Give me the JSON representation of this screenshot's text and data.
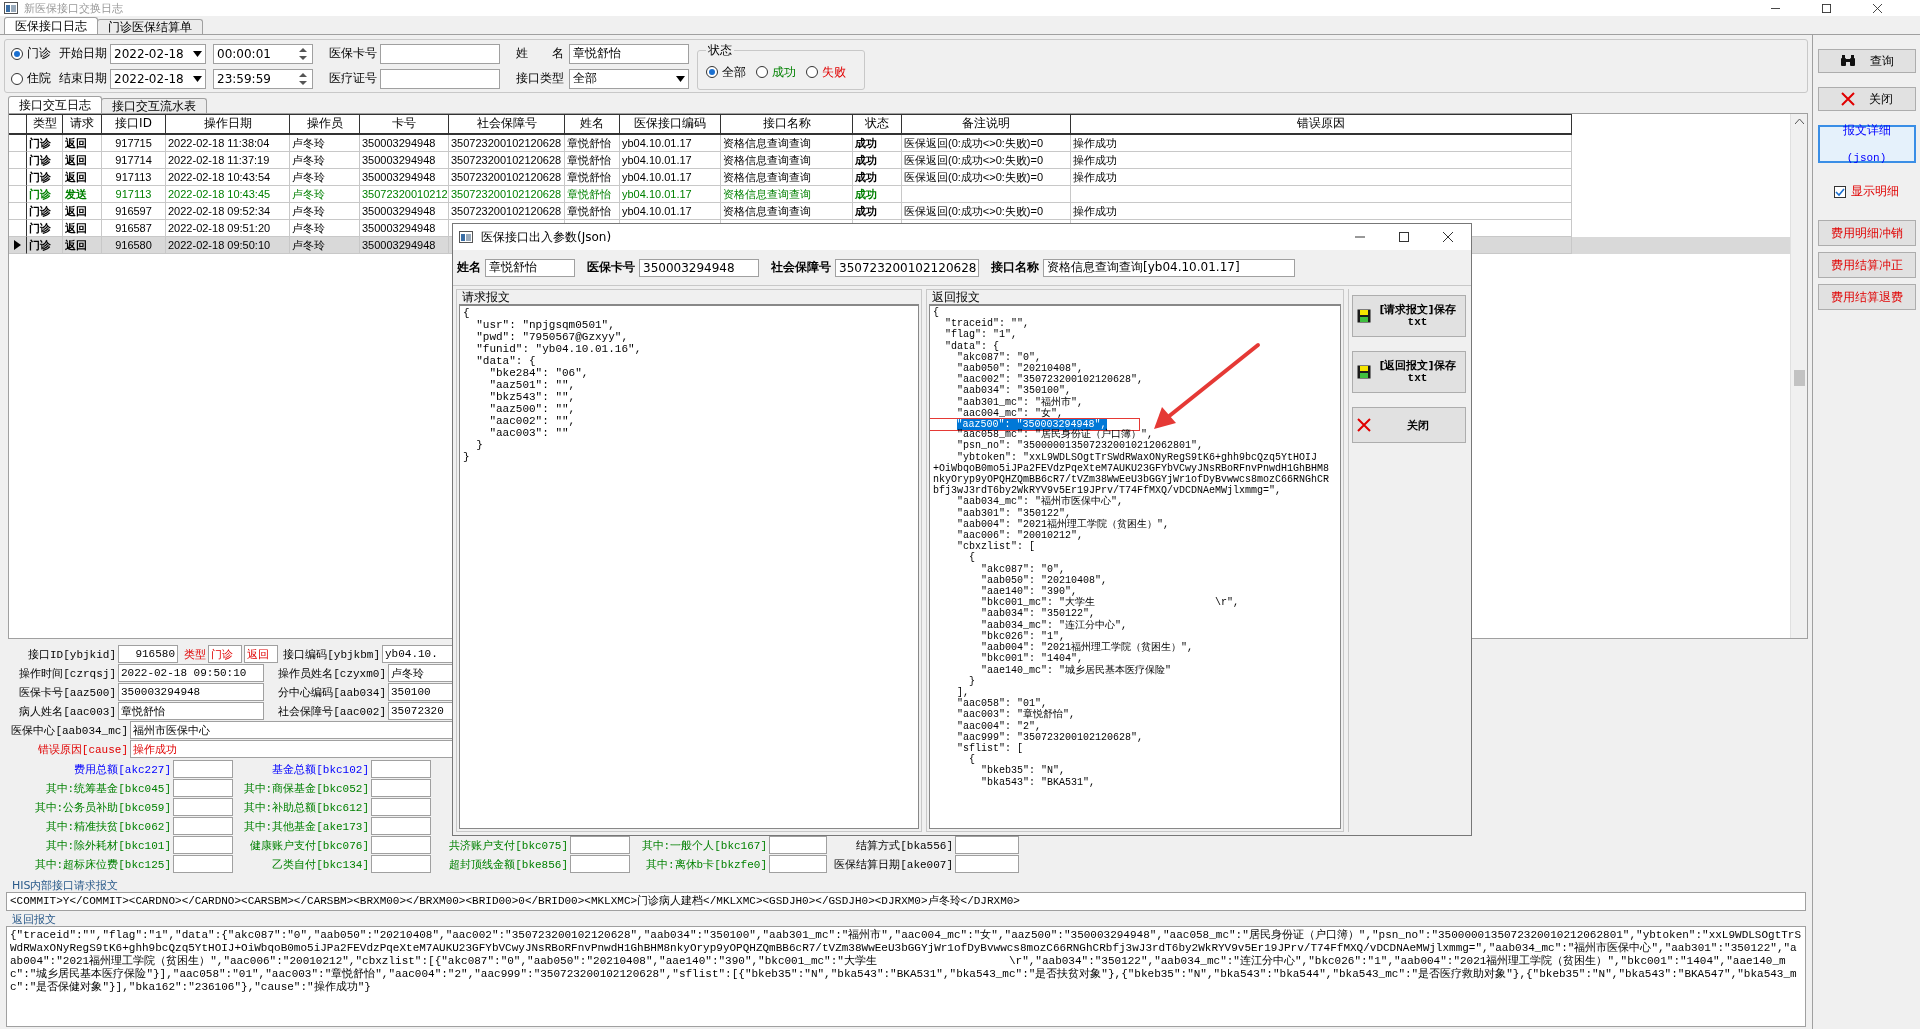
{
  "window": {
    "title": "新医保接口交换日志"
  },
  "main_tabs": [
    {
      "label": "医保接口日志",
      "selected": true
    },
    {
      "label": "门诊医保结算单",
      "selected": false
    }
  ],
  "filter": {
    "visit_types": [
      {
        "label": "门诊",
        "selected": true
      },
      {
        "label": "住院",
        "selected": false
      }
    ],
    "start_date": {
      "label": "开始日期",
      "date": "2022-02-18",
      "time": "00:00:01"
    },
    "end_date": {
      "label": "结束日期",
      "date": "2022-02-18",
      "time": "23:59:59"
    },
    "card_no": {
      "label": "医保卡号"
    },
    "medical_no": {
      "label": "医疗证号"
    },
    "name": {
      "label": "姓　　名",
      "value": "章悦舒怡"
    },
    "interface_type": {
      "label": "接口类型",
      "value": "全部"
    },
    "status": {
      "title": "状态",
      "options": [
        {
          "label": "全部",
          "kind": "all",
          "selected": true
        },
        {
          "label": "成功",
          "kind": "success",
          "selected": false
        },
        {
          "label": "失败",
          "kind": "fail",
          "selected": false
        }
      ]
    }
  },
  "sub_tabs": [
    {
      "label": "接口交互日志",
      "selected": true
    },
    {
      "label": "接口交互流水表",
      "selected": false
    }
  ],
  "table": {
    "columns": [
      "类型",
      "请求",
      "接口ID",
      "操作日期",
      "操作员",
      "卡号",
      "社会保障号",
      "姓名",
      "医保接口编码",
      "接口名称",
      "状态",
      "备注说明",
      "错误原因"
    ],
    "rows": [
      {
        "kind": "return",
        "selected": false,
        "cells": [
          "门诊",
          "返回",
          "917715",
          "2022-02-18 11:38:04",
          "卢冬玲",
          "350003294948",
          "350723200102120628",
          "章悦舒怡",
          "yb04.10.01.17",
          "资格信息查询查询",
          "成功",
          "医保返回(0:成功<>0:失败)=0",
          "操作成功"
        ]
      },
      {
        "kind": "return",
        "selected": false,
        "cells": [
          "门诊",
          "返回",
          "917714",
          "2022-02-18 11:37:19",
          "卢冬玲",
          "350003294948",
          "350723200102120628",
          "章悦舒怡",
          "yb04.10.01.17",
          "资格信息查询查询",
          "成功",
          "医保返回(0:成功<>0:失败)=0",
          "操作成功"
        ]
      },
      {
        "kind": "return",
        "selected": false,
        "cells": [
          "门诊",
          "返回",
          "917113",
          "2022-02-18 10:43:54",
          "卢冬玲",
          "350003294948",
          "350723200102120628",
          "章悦舒怡",
          "yb04.10.01.17",
          "资格信息查询查询",
          "成功",
          "医保返回(0:成功<>0:失败)=0",
          "操作成功"
        ]
      },
      {
        "kind": "send",
        "selected": false,
        "cells": [
          "门诊",
          "发送",
          "917113",
          "2022-02-18 10:43:45",
          "卢冬玲",
          "35072320010212",
          "350723200102120628",
          "章悦舒怡",
          "yb04.10.01.17",
          "资格信息查询查询",
          "成功"
        ]
      },
      {
        "kind": "return",
        "selected": false,
        "cells": [
          "门诊",
          "返回",
          "916597",
          "2022-02-18 09:52:34",
          "卢冬玲",
          "350003294948",
          "350723200102120628",
          "章悦舒怡",
          "yb04.10.01.17",
          "资格信息查询查询",
          "成功",
          "医保返回(0:成功<>0:失败)=0",
          "操作成功"
        ]
      },
      {
        "kind": "return",
        "selected": false,
        "cells": [
          "门诊",
          "返回",
          "916587",
          "2022-02-18 09:51:20",
          "卢冬玲",
          "350003294948"
        ]
      },
      {
        "kind": "return",
        "selected": true,
        "cells": [
          "门诊",
          "返回",
          "916580",
          "2022-02-18 09:50:10",
          "卢冬玲",
          "350003294948"
        ]
      }
    ]
  },
  "detail": {
    "id": {
      "label": "接口ID[ybjkid]",
      "value": "916580"
    },
    "type": {
      "label": "类型",
      "values": [
        "门诊",
        "返回"
      ]
    },
    "code": {
      "label": "接口编码[ybjkbm]",
      "value": "yb04.10."
    },
    "pairs": [
      [
        {
          "label": "操作时间[czrqsj]",
          "value": "2022-02-18 09:50:10"
        },
        {
          "label": "操作员姓名[czyxm0]",
          "value": "卢冬玲"
        }
      ],
      [
        {
          "label": "医保卡号[aaz500]",
          "value": "350003294948"
        },
        {
          "label": "分中心编码[aab034]",
          "value": "350100"
        }
      ],
      [
        {
          "label": "病人姓名[aac003]",
          "value": "章悦舒怡"
        },
        {
          "label": "社会保障号[aac002]",
          "value": "35072320"
        }
      ]
    ],
    "center": {
      "label": "医保中心[aab034_mc]",
      "value": "福州市医保中心"
    },
    "cause": {
      "label": "错误原因[cause]",
      "value": "操作成功"
    }
  },
  "fees": [
    [
      {
        "label": "费用总额[akc227]",
        "kind": "total"
      },
      {
        "label": "基金总额[bkc102]",
        "kind": "total"
      }
    ],
    [
      {
        "label": "其中:统筹基金[bkc045]",
        "kind": "part"
      },
      {
        "label": "其中:商保基金[bkc052]",
        "kind": "part"
      }
    ],
    [
      {
        "label": "其中:公务员补助[bkc059]",
        "kind": "part"
      },
      {
        "label": "其中:补助总额[bkc612]",
        "kind": "part"
      }
    ],
    [
      {
        "label": "其中:精准扶贫[bkc062]",
        "kind": "part"
      },
      {
        "label": "其中:其他基金[ake173]",
        "kind": "part"
      }
    ],
    [
      {
        "label": "其中:除外耗材[bkc101]",
        "kind": "part"
      },
      {
        "label": "健康账户支付[bkc076]",
        "kind": "part"
      },
      {
        "label": "共济账户支付[bkc075]",
        "kind": "part"
      },
      {
        "label": "其中:一般个人[bkc167]",
        "kind": "part"
      },
      {
        "label": "结算方式[bka556]",
        "kind": "plain"
      }
    ],
    [
      {
        "label": "其中:超标床位费[bkc125]",
        "kind": "part"
      },
      {
        "label": "乙类自付[bkc134]",
        "kind": "part"
      },
      {
        "label": "超封顶线金额[bke856]",
        "kind": "part"
      },
      {
        "label": "其中:离休b卡[bkzfe0]",
        "kind": "part"
      },
      {
        "label": "医保结算日期[ake007]",
        "kind": "plain"
      }
    ]
  ],
  "his_request": {
    "title": "HIS内部接口请求报文",
    "text": "<COMMIT>Y</COMMIT><CARDNO></CARDNO><CARSBM></CARSBM><BRXM00></BRXM00><BRID00>0</BRID00><MKLXMC>门诊病人建档</MKLXMC><GSDJH0></GSDJH0><DJRXM0>卢冬玲</DJRXM0>"
  },
  "his_response": {
    "title": "返回报文",
    "text": "{\"traceid\":\"\",\"flag\":\"1\",\"data\":{\"akc087\":\"0\",\"aab050\":\"20210408\",\"aac002\":\"350723200102120628\",\"aab034\":\"350100\",\"aab301_mc\":\"福州市\",\"aac004_mc\":\"女\",\"aaz500\":\"350003294948\",\"aac058_mc\":\"居民身份证（户口簿）\",\"psn_no\":\"3500000135072320010212062801\",\"ybtoken\":\"xxL9WDLSOgtTrSWdRWaxONyRegS9tK6+ghh9bcQzq5YtHOIJ+OiWbqoB0mo5iJPa2FEVdzPqeXteM7AUKU23GFYbVCwyJNsRBoRFnvPnwdH1GhBHM8nkyOryp9yOPQHZQmBB6cR7/tVZm38WwEeU3bGGYjWr1ofDyBvwwcs8mozC66RNGhCRbfj3wJ3rdT6by2WkRYV9v5Er19JPrv/T74FfMXQ/vDCDNAeMWjlxmmg=\",\"aab034_mc\":\"福州市医保中心\",\"aab301\":\"350122\",\"aab004\":\"2021福州理工学院（贫困生）\",\"aac006\":\"20010212\",\"cbxzlist\":[{\"akc087\":\"0\",\"aab050\":\"20210408\",\"aae140\":\"390\",\"bkc001_mc\":\"大学生                    \\r\",\"aab034\":\"350122\",\"aab034_mc\":\"连江分中心\",\"bkc026\":\"1\",\"aab004\":\"2021福州理工学院（贫困生）\",\"bkc001\":\"1404\",\"aae140_mc\":\"城乡居民基本医疗保险\"}],\"aac058\":\"01\",\"aac003\":\"章悦舒怡\",\"aac004\":\"2\",\"aac999\":\"350723200102120628\",\"sflist\":[{\"bkeb35\":\"N\",\"bka543\":\"BKA531\",\"bka543_mc\":\"是否扶贫对象\"},{\"bkeb35\":\"N\",\"bka543\":\"bka544\",\"bka543_mc\":\"是否医疗救助对象\"},{\"bkeb35\":\"N\",\"bka543\":\"BKA547\",\"bka543_mc\":\"是否保健对象\"}],\"bka162\":\"236106\"},\"cause\":\"操作成功\"}"
  },
  "side_buttons": [
    {
      "label": "查询",
      "kind": "search"
    },
    {
      "label": "关闭",
      "kind": "close"
    },
    {
      "label": "报文详细",
      "sublabel": "(json)",
      "kind": "detail"
    }
  ],
  "show_detail": {
    "label": "显示明细",
    "checked": true
  },
  "actions": [
    "费用明细冲销",
    "费用结算冲正",
    "费用结算退费"
  ],
  "dialog": {
    "title": "医保接口出入参数(Json)",
    "fields": [
      {
        "label": "姓名",
        "value": "章悦舒怡"
      },
      {
        "label": "医保卡号",
        "value": "350003294948"
      },
      {
        "label": "社会保障号",
        "value": "350723200102120628"
      },
      {
        "label": "接口名称",
        "value": "资格信息查询查询[yb04.10.01.17]"
      }
    ],
    "request": {
      "title": "请求报文",
      "text": "{\n  \"usr\": \"npjgsqm0501\",\n  \"pwd\": \"7950567@Gzxyy\",\n  \"funid\": \"yb04.10.01.16\",\n  \"data\": {\n    \"bke284\": \"06\",\n    \"aaz501\": \"\",\n    \"bkz543\": \"\",\n    \"aaz500\": \"\",\n    \"aac002\": \"\",\n    \"aac003\": \"\"\n  }\n}"
    },
    "response": {
      "title": "返回报文",
      "before": "{\n  \"traceid\": \"\",\n  \"flag\": \"1\",\n  \"data\": {\n    \"akc087\": \"0\",\n    \"aab050\": \"20210408\",\n    \"aac002\": \"350723200102120628\",\n    \"aab034\": \"350100\",\n    \"aab301_mc\": \"福州市\",\n    \"aac004_mc\": \"女\",",
      "selected": "\"aaz500\": \"350003294948\",",
      "after": "    \"aac058_mc\": \"居民身份证（户口簿）\",\n    \"psn_no\": \"3500000135072320010212062801\",\n    \"ybtoken\": \"xxL9WDLSOgtTrSWdRWaxONyRegS9tK6+ghh9bcQzq5YtHOIJ\n+OiWbqoB0mo5iJPa2FEVdzPqeXteM7AUKU23GFYbVCwyJNsRBoRFnvPnwdH1GhBHM8\nnkyOryp9yOPQHZQmBB6cR7/tVZm38WwEeU3bGGYjWr1ofDyBvwwcs8mozC66RNGhCR\nbfj3wJ3rdT6by2WkRYV9v5Er19JPrv/T74FfMXQ/vDCDNAeMWjlxmmg=\",\n    \"aab034_mc\": \"福州市医保中心\",\n    \"aab301\": \"350122\",\n    \"aab004\": \"2021福州理工学院（贫困生）\",\n    \"aac006\": \"20010212\",\n    \"cbxzlist\": [\n      {\n        \"akc087\": \"0\",\n        \"aab050\": \"20210408\",\n        \"aae140\": \"390\",\n        \"bkc001_mc\": \"大学生                    \\r\",\n        \"aab034\": \"350122\",\n        \"aab034_mc\": \"连江分中心\",\n        \"bkc026\": \"1\",\n        \"aab004\": \"2021福州理工学院（贫困生）\",\n        \"bkc001\": \"1404\",\n        \"aae140_mc\": \"城乡居民基本医疗保险\"\n      }\n    ],\n    \"aac058\": \"01\",\n    \"aac003\": \"章悦舒怡\",\n    \"aac004\": \"2\",\n    \"aac999\": \"350723200102120628\",\n    \"sflist\": [\n      {\n        \"bkeb35\": \"N\",\n        \"bka543\": \"BKA531\","
    },
    "buttons": [
      {
        "label": "[请求报文]保存",
        "sublabel": "txt",
        "kind": "save"
      },
      {
        "label": "[返回报文]保存",
        "sublabel": "txt",
        "kind": "save"
      },
      {
        "label": "关闭",
        "kind": "close"
      }
    ]
  }
}
